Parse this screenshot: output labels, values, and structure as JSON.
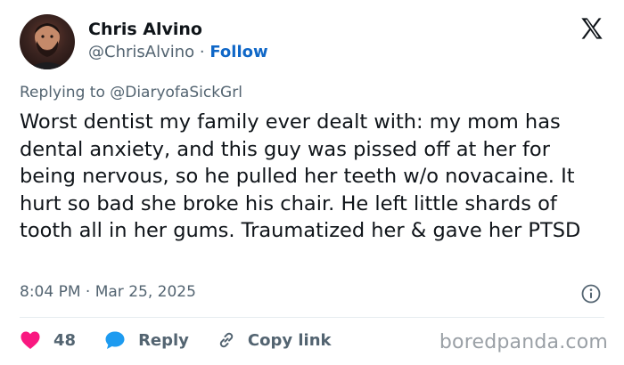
{
  "author": {
    "name": "Chris Alvino",
    "handle": "@ChrisAlvino",
    "separator": "·",
    "follow_label": "Follow",
    "avatar": "avatar-photo"
  },
  "platform_icon": "x-logo-icon",
  "reply_context": "Replying to @DiaryofaSickGrl",
  "tweet_text": "Worst dentist my family ever dealt with: my mom has dental anxiety, and this guy was pissed off at her for being nervous, so he pulled her teeth w/o novacaine. It hurt so bad she broke his chair. He left little shards of tooth all in her gums. Traumatized her & gave her PTSD",
  "timestamp": "8:04 PM · Mar 25, 2025",
  "info_icon": "info-icon",
  "actions": {
    "likes": "48",
    "reply_label": "Reply",
    "copy_label": "Copy link"
  },
  "watermark": "boredpanda.com",
  "colors": {
    "like": "#f91880",
    "reply": "#1d9bf0",
    "link": "#0f67c7",
    "muted": "#536471"
  }
}
